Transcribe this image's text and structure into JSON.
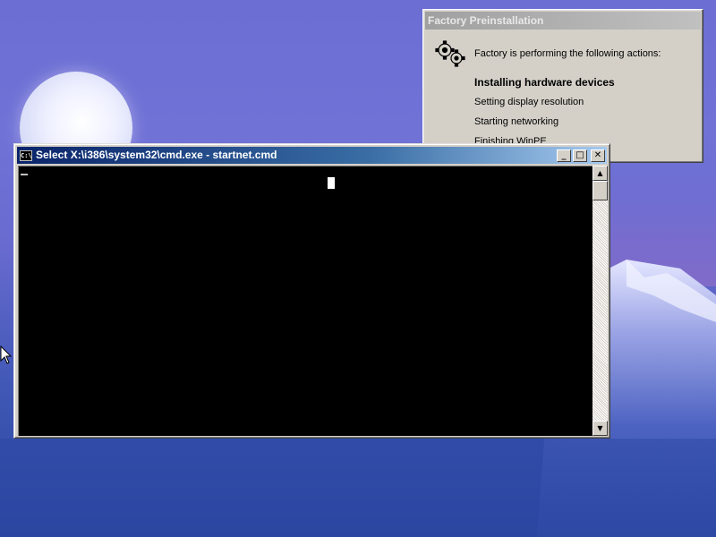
{
  "factory_dialog": {
    "title": "Factory Preinstallation",
    "icon": "gears-icon",
    "intro": "Factory is performing the following actions:",
    "steps": [
      {
        "label": "Installing hardware devices",
        "active": true
      },
      {
        "label": "Setting display resolution",
        "active": false
      },
      {
        "label": "Starting networking",
        "active": false
      },
      {
        "label": "Finishing WinPE",
        "active": false
      }
    ]
  },
  "cmd_window": {
    "title": "Select X:\\i386\\system32\\cmd.exe - startnet.cmd",
    "icon_text": "C:\\",
    "buttons": {
      "minimize": "_",
      "maximize": "□",
      "close": "✕"
    },
    "scroll_up": "▲",
    "scroll_down": "▼"
  },
  "colors": {
    "title_bar_active": "#0a246a",
    "title_bar_inactive": "#a0a0a0",
    "dialog_face": "#d4d0c8",
    "console_bg": "#000000"
  }
}
